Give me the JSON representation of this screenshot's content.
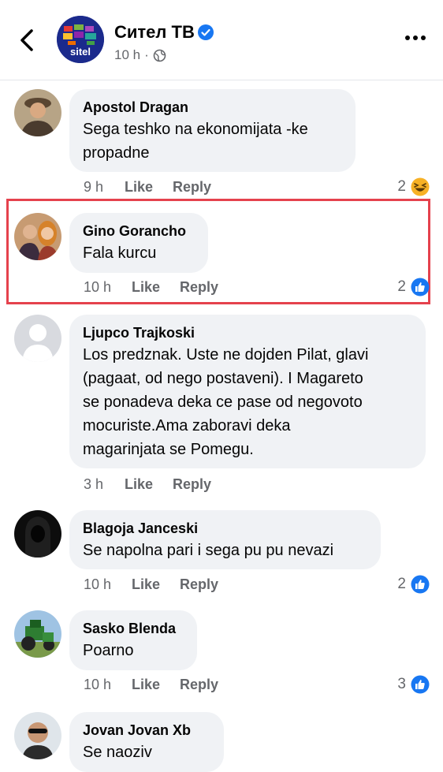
{
  "header": {
    "page_name": "Сител ТВ",
    "time": "10 h",
    "separator": "·",
    "logo_text": "sitel"
  },
  "comments": [
    {
      "author": "Apostol Dragan",
      "text": "Sega teshko na ekonomijata -ke\npropadne",
      "time": "9 h",
      "like": "Like",
      "reply": "Reply",
      "reaction_count": "2",
      "reaction": "haha"
    },
    {
      "author": "Gino Gorancho",
      "text": "Fala kurcu",
      "time": "10 h",
      "like": "Like",
      "reply": "Reply",
      "reaction_count": "2",
      "reaction": "like"
    },
    {
      "author": "Ljupco Trajkoski",
      "text": "Los predznak. Uste ne dojden Pilat, glavi\n(pagaat, od nego postaveni). I Magareto\nse ponadeva deka ce pase od negovoto\nmocuriste.Ama zaboravi deka\nmagarinjata se Pomegu.",
      "time": "3 h",
      "like": "Like",
      "reply": "Reply",
      "reaction_count": "",
      "reaction": ""
    },
    {
      "author": "Blagoja Janceski",
      "text": "Se napolna pari i sega pu pu nevazi",
      "time": "10 h",
      "like": "Like",
      "reply": "Reply",
      "reaction_count": "2",
      "reaction": "like"
    },
    {
      "author": "Sasko Blenda",
      "text": "Poarno",
      "time": "10 h",
      "like": "Like",
      "reply": "Reply",
      "reaction_count": "3",
      "reaction": "like"
    },
    {
      "author": "Jovan Jovan Xb",
      "text": "Se naoziv",
      "time": "",
      "like": "",
      "reply": "",
      "reaction_count": "",
      "reaction": ""
    }
  ],
  "colors": {
    "like_blue": "#1877f2",
    "haha_yellow": "#f7b125",
    "highlight_red": "#e5424d"
  }
}
